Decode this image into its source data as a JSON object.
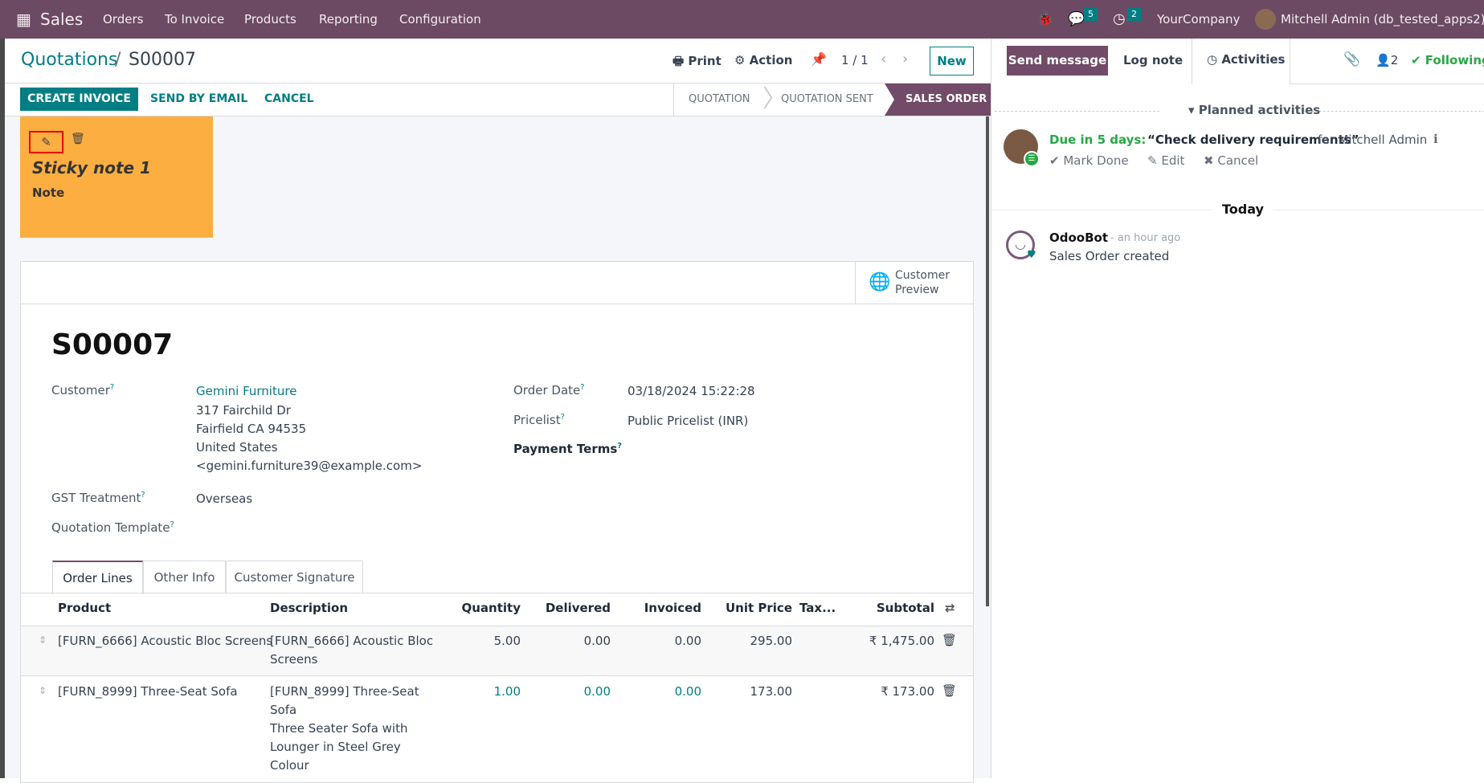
{
  "navbar": {
    "app": "Sales",
    "menu": [
      "Orders",
      "To Invoice",
      "Products",
      "Reporting",
      "Configuration"
    ],
    "messages_count": "5",
    "activities_count": "2",
    "company": "YourCompany",
    "user": "Mitchell Admin (db_tested_apps2)"
  },
  "control_panel": {
    "breadcrumb_parent": "Quotations",
    "breadcrumb_sep": "/",
    "breadcrumb_current": "S00007",
    "print": "Print",
    "action": "Action",
    "pager": "1 / 1",
    "new": "New"
  },
  "statusbar": {
    "buttons": [
      "CREATE INVOICE",
      "SEND BY EMAIL",
      "CANCEL"
    ],
    "stages": [
      "QUOTATION",
      "QUOTATION SENT",
      "SALES ORDER"
    ],
    "active_stage": "SALES ORDER"
  },
  "sticky_note": {
    "title": "Sticky note 1",
    "body": "Note",
    "color": "#fcae41"
  },
  "form": {
    "customer_preview": "Customer Preview",
    "name": "S00007",
    "customer_label": "Customer",
    "customer": "Gemini Furniture",
    "address": [
      "317 Fairchild Dr",
      "Fairfield CA 94535",
      "United States",
      "<gemini.furniture39@example.com>"
    ],
    "gst_label": "GST Treatment",
    "gst": "Overseas",
    "template_label": "Quotation Template",
    "order_date_label": "Order Date",
    "order_date": "03/18/2024 15:22:28",
    "pricelist_label": "Pricelist",
    "pricelist": "Public Pricelist (INR)",
    "payment_terms_label": "Payment Terms",
    "help": "?"
  },
  "tabs": [
    "Order Lines",
    "Other Info",
    "Customer Signature"
  ],
  "table": {
    "headers": [
      "Product",
      "Description",
      "Quantity",
      "Delivered",
      "Invoiced",
      "Unit Price",
      "Tax...",
      "Subtotal"
    ],
    "rows": [
      {
        "product": "[FURN_6666] Acoustic Bloc Screens",
        "description": [
          "[FURN_6666] Acoustic Bloc",
          "Screens"
        ],
        "quantity": "5.00",
        "delivered": "0.00",
        "invoiced": "0.00",
        "unit_price": "295.00",
        "subtotal": "₹ 1,475.00"
      },
      {
        "product": "[FURN_8999] Three-Seat Sofa",
        "description": [
          "[FURN_8999] Three-Seat",
          "Sofa",
          "Three Seater Sofa with",
          "Lounger in Steel Grey",
          "Colour"
        ],
        "quantity": "1.00",
        "delivered": "0.00",
        "invoiced": "0.00",
        "unit_price": "173.00",
        "subtotal": "₹ 173.00"
      }
    ]
  },
  "chatter": {
    "send_message": "Send message",
    "log_note": "Log note",
    "activities": "Activities",
    "followers_count": "2",
    "following": "Following",
    "planned": "Planned activities",
    "due": "Due in 5 days:",
    "activity_title": "“Check delivery requirements”",
    "activity_for": "for Mitchell Admin",
    "mark_done": "Mark Done",
    "edit": "Edit",
    "cancel": "Cancel",
    "today": "Today",
    "message": {
      "author": "OdooBot",
      "time": "- an hour ago",
      "body": "Sales Order created"
    }
  },
  "colors": {
    "brand": "#714b67",
    "accent": "#017e84",
    "success": "#28a745"
  }
}
